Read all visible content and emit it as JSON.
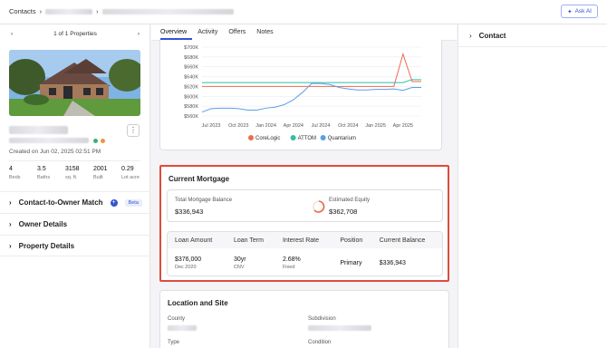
{
  "breadcrumb": {
    "root": "Contacts",
    "sep": "›"
  },
  "ask_ai": {
    "label": "Ask AI"
  },
  "pager": {
    "label": "1 of 1 Properties"
  },
  "property": {
    "created": "Created on Jun 02, 2025 02:51 PM",
    "stats": [
      {
        "value": "4",
        "label": "Beds"
      },
      {
        "value": "3.5",
        "label": "Baths"
      },
      {
        "value": "3158",
        "label": "sq. ft."
      },
      {
        "value": "2001",
        "label": "Built"
      },
      {
        "value": "0.29",
        "label": "Lot acre"
      }
    ]
  },
  "sections": {
    "owner_match": "Contact-to-Owner Match",
    "beta": "Beta",
    "owner_details": "Owner Details",
    "property_details": "Property Details"
  },
  "tabs": [
    "Overview",
    "Activity",
    "Offers",
    "Notes"
  ],
  "chart_data": {
    "type": "line",
    "title": "",
    "xlabel": "",
    "ylabel": "",
    "y_ticks": [
      "$700K",
      "$680K",
      "$660K",
      "$640K",
      "$620K",
      "$600K",
      "$580K",
      "$560K"
    ],
    "ylim": [
      560000,
      700000
    ],
    "x_ticks": [
      "Jul 2023",
      "Oct 2023",
      "Jan 2024",
      "Apr 2024",
      "Jul 2024",
      "Oct 2024",
      "Jan 2025",
      "Apr 2025"
    ],
    "x": [
      "2023-06",
      "2023-07",
      "2023-08",
      "2023-09",
      "2023-10",
      "2023-11",
      "2023-12",
      "2024-01",
      "2024-02",
      "2024-03",
      "2024-04",
      "2024-05",
      "2024-06",
      "2024-07",
      "2024-08",
      "2024-09",
      "2024-10",
      "2024-11",
      "2024-12",
      "2025-01",
      "2025-02",
      "2025-03",
      "2025-04",
      "2025-05",
      "2025-06"
    ],
    "series": [
      {
        "name": "CoreLogic",
        "color": "#ef6a4f",
        "values": [
          620000,
          620000,
          620000,
          620000,
          620000,
          620000,
          620000,
          620000,
          620000,
          620000,
          620000,
          620000,
          620000,
          620000,
          620000,
          620000,
          620000,
          620000,
          620000,
          620000,
          620000,
          620000,
          686000,
          630000,
          630000
        ]
      },
      {
        "name": "ATTOM",
        "color": "#2fbfa5",
        "values": [
          628000,
          628000,
          628000,
          628000,
          628000,
          628000,
          628000,
          628000,
          628000,
          628000,
          628000,
          628000,
          628000,
          628000,
          628000,
          628000,
          628000,
          628000,
          628000,
          628000,
          628000,
          628000,
          628000,
          634000,
          634000
        ]
      },
      {
        "name": "Quantarium",
        "color": "#5b9ee8",
        "values": [
          568000,
          575000,
          576000,
          576000,
          575000,
          572000,
          572000,
          576000,
          578000,
          583000,
          593000,
          608000,
          626000,
          626000,
          624000,
          618000,
          615000,
          613000,
          613000,
          614000,
          614000,
          615000,
          612000,
          618000,
          618000
        ]
      }
    ]
  },
  "mortgage": {
    "title": "Current Mortgage",
    "total_label": "Total Mortgage Balance",
    "total_value": "$336,943",
    "equity_label": "Estimated Equity",
    "equity_value": "$362,708",
    "columns": [
      "Loan Amount",
      "Loan Term",
      "Interest Rate",
      "Position",
      "Current Balance"
    ],
    "row": {
      "loan_amount": "$376,000",
      "loan_date": "Dec 2020",
      "term": "30yr",
      "term_type": "CNV",
      "rate": "2.68%",
      "rate_type": "Fixed",
      "position": "Primary",
      "balance": "$336,943"
    }
  },
  "location": {
    "title": "Location and Site",
    "county_label": "County",
    "subdivision_label": "Subdivision",
    "type_label": "Type",
    "condition_label": "Condition"
  },
  "contact": {
    "title": "Contact"
  },
  "colors": {
    "accent": "#3454d1",
    "highlight": "#e04b3a"
  }
}
